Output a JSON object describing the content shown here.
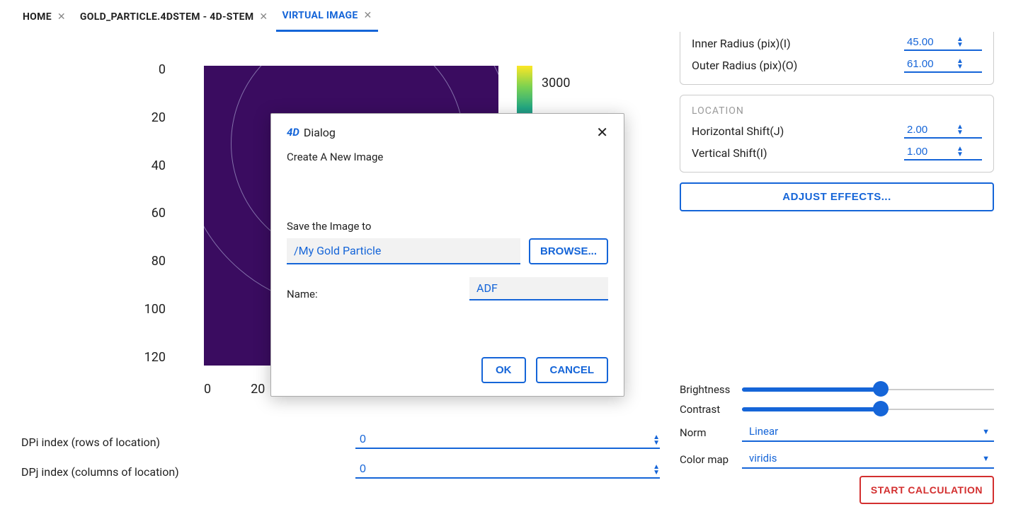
{
  "tabs": [
    {
      "label": "HOME",
      "closable": true,
      "active": false
    },
    {
      "label": "GOLD_PARTICLE.4DSTEM - 4D-STEM",
      "closable": true,
      "active": false
    },
    {
      "label": "VIRTUAL IMAGE",
      "closable": true,
      "active": true
    }
  ],
  "plot": {
    "y_ticks": [
      "0",
      "20",
      "40",
      "60",
      "80",
      "100",
      "120"
    ],
    "x_ticks": [
      "0",
      "20"
    ],
    "colorbar_label": "3000"
  },
  "indices": {
    "dpi": {
      "label": "DPi index (rows of location)",
      "value": "0"
    },
    "dpj": {
      "label": "DPj index (columns of location)",
      "value": "0"
    }
  },
  "right": {
    "radius_group": {
      "inner": {
        "label": "Inner Radius (pix)(I)",
        "value": "45.00"
      },
      "outer": {
        "label": "Outer Radius (pix)(O)",
        "value": "61.00"
      }
    },
    "location_group": {
      "title": "LOCATION",
      "hshift": {
        "label": "Horizontal Shift(J)",
        "value": "2.00"
      },
      "vshift": {
        "label": "Vertical Shift(I)",
        "value": "1.00"
      }
    },
    "adjust_button": "ADJUST EFFECTS...",
    "brightness_label": "Brightness",
    "contrast_label": "Contrast",
    "norm": {
      "label": "Norm",
      "value": "Linear"
    },
    "colormap": {
      "label": "Color map",
      "value": "viridis"
    },
    "start_button": "START CALCULATION"
  },
  "dialog": {
    "title": "Dialog",
    "subtitle": "Create A New Image",
    "save_label": "Save the Image to",
    "path_value": "/My Gold Particle",
    "browse": "BROWSE...",
    "name_label": "Name:",
    "name_value": "ADF",
    "ok": "OK",
    "cancel": "CANCEL"
  }
}
